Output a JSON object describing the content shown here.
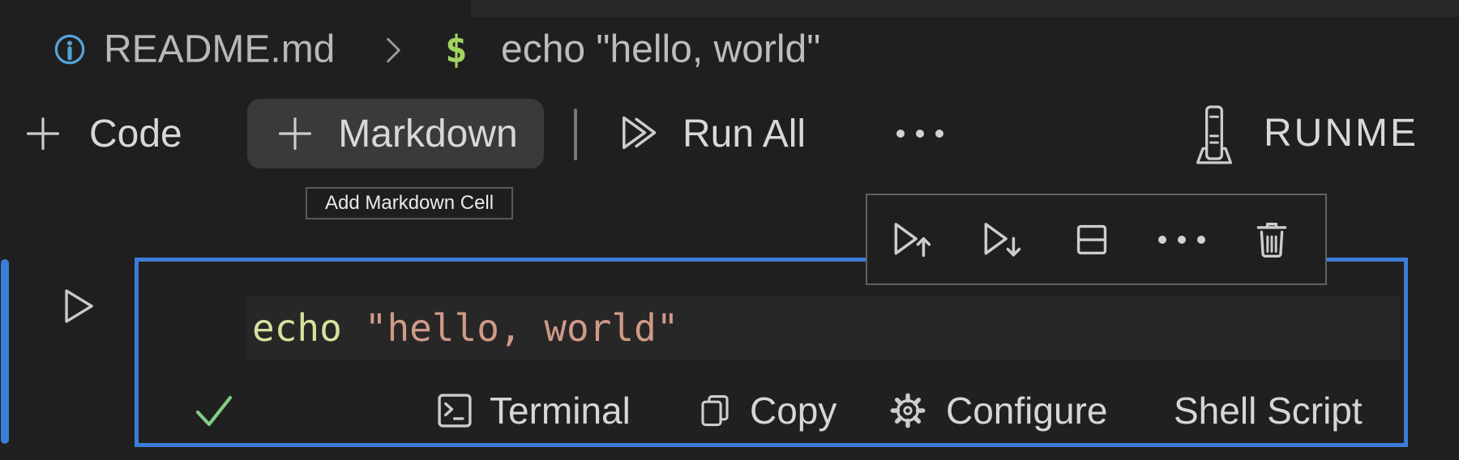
{
  "breadcrumb": {
    "file": "README.md",
    "separator": ">",
    "prompt": "$",
    "command": "echo \"hello, world\""
  },
  "notebook_toolbar": {
    "add_code_label": "Code",
    "add_markdown_label": "Markdown",
    "run_all_label": "Run All",
    "more_actions_icon": "ellipsis",
    "brand_label": "RUNME",
    "brand_icon": "runme-rocket"
  },
  "tooltip": {
    "text": "Add Markdown Cell"
  },
  "cell_toolbar": {
    "buttons": [
      "execute-above",
      "execute-below",
      "split-cell",
      "more-actions",
      "delete-cell"
    ]
  },
  "cell": {
    "run_icon": "play-outline",
    "code": {
      "keyword": "echo",
      "string": "\"hello, world\""
    },
    "status_bar": {
      "success_icon": "check",
      "terminal_label": "Terminal",
      "copy_label": "Copy",
      "configure_label": "Configure",
      "language_label": "Shell Script"
    }
  },
  "colors": {
    "background": "#1f1f1f",
    "top_strip": "#282828",
    "accent_blue": "#3c7cd9",
    "success_green": "#82cc87",
    "prompt_green": "#a2d45e",
    "code_keyword": "#d9df9e",
    "code_string": "#d09a87",
    "info_blue": "#56a2d8",
    "button_hover_bg": "#3a3a3a"
  }
}
